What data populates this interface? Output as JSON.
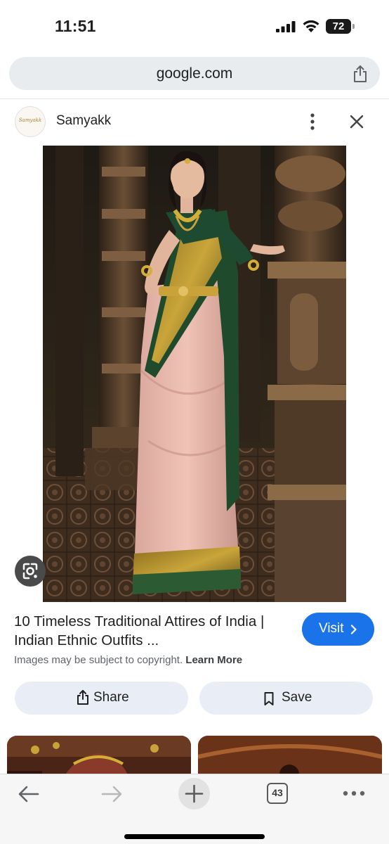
{
  "status_bar": {
    "time": "11:51",
    "battery": "72"
  },
  "address_bar": {
    "url": "google.com"
  },
  "source": {
    "logo_text": "Samyakk",
    "name": "Samyakk"
  },
  "result": {
    "title_line1": "10 Timeless Traditional Attires of India |",
    "title_line2": "Indian Ethnic Outfits ...",
    "visit_label": "Visit",
    "copyright_text": "Images may be subject to copyright.",
    "learn_more_label": "Learn More"
  },
  "actions": {
    "share_label": "Share",
    "save_label": "Save"
  },
  "toolbar": {
    "tab_count": "43"
  },
  "colors": {
    "accent": "#1a73e8",
    "button_bg": "#e9eef6",
    "address_bar_bg": "#e9ecef"
  }
}
